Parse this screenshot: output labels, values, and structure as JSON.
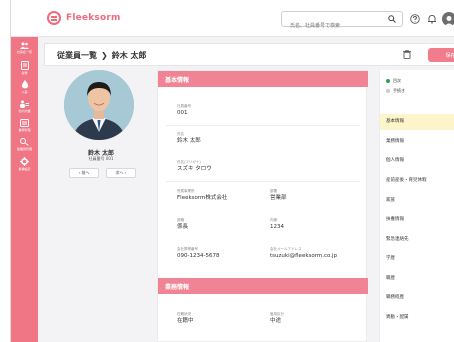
{
  "app": {
    "logo_text": "Fleeksorm",
    "brand_color": "#f07585",
    "accent_color": "#f17d8c"
  },
  "header": {
    "search_placeholder": "氏名、社員番号で検索"
  },
  "sidebar": {
    "items": [
      {
        "label": "社員名一覧",
        "icon": "people-icon"
      },
      {
        "label": "労務",
        "icon": "document-icon"
      },
      {
        "label": "人事",
        "icon": "drop-icon"
      },
      {
        "label": "社内文書",
        "icon": "person-group-icon"
      },
      {
        "label": "書類管理",
        "icon": "folder-icon"
      },
      {
        "label": "従業員管理",
        "icon": "person-search-icon"
      },
      {
        "label": "各種設定",
        "icon": "gear-icon"
      }
    ]
  },
  "titlebar": {
    "list_label": "従業員一覧",
    "chevron": "❯",
    "employee": "鈴木 太郎",
    "save_label": "保存"
  },
  "profile": {
    "name": "鈴木 太郎",
    "employee_no": "社員番号 001",
    "prev_label": "前へ",
    "next_label": "次へ"
  },
  "sections": {
    "basic": "基本情報",
    "work": "業務情報"
  },
  "fields": {
    "emp_no": {
      "label": "社員番号",
      "value": "001"
    },
    "name": {
      "label": "氏名",
      "value": "鈴木 太郎"
    },
    "kana": {
      "label": "氏名(フリガナ)",
      "value": "スズキ タロウ"
    },
    "company": {
      "label": "所属事業所",
      "value": "Fleeksorm株式会社"
    },
    "dept": {
      "label": "部署",
      "value": "営業部"
    },
    "title": {
      "label": "役職",
      "value": "係長"
    },
    "ext": {
      "label": "内線",
      "value": "1234"
    },
    "phone": {
      "label": "会社携帯番号",
      "value": "090-1234-5678"
    },
    "email": {
      "label": "会社メールアドレス",
      "value": "tsuzuki@fleeksorm.co.jp"
    },
    "status": {
      "label": "在籍状況",
      "value": "在籍中"
    },
    "emp_type": {
      "label": "雇用区分",
      "value": "中途"
    }
  },
  "right_nav": {
    "legend": [
      {
        "label": "目次",
        "color": "#2ea44f"
      },
      {
        "label": "手続き",
        "color": "#cccccc"
      }
    ],
    "items": [
      "基本情報",
      "業務情報",
      "個人情報",
      "産前産後・育児休暇",
      "家族",
      "扶養情報",
      "緊急連絡先",
      "学歴",
      "職歴",
      "職務経歴",
      "異動・配属"
    ],
    "active_index": 0
  }
}
